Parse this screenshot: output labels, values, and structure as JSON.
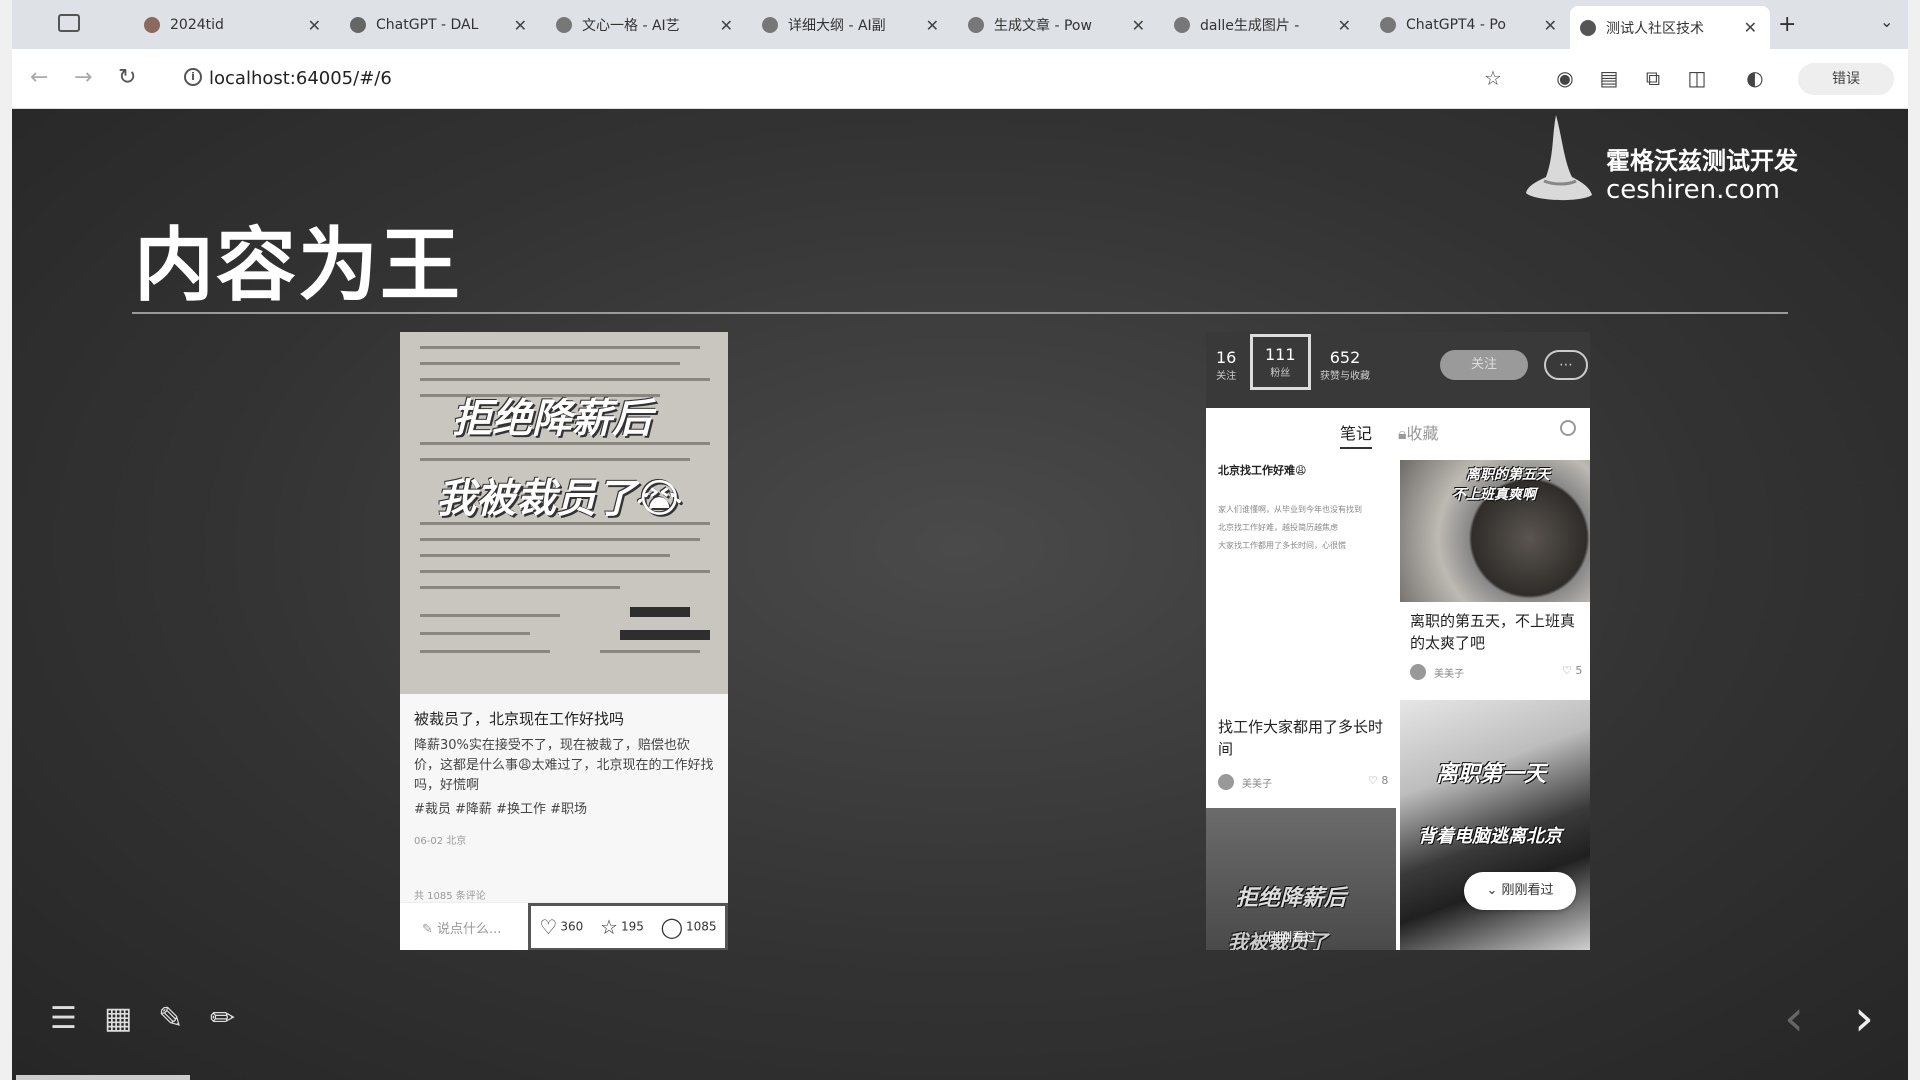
{
  "browser": {
    "tabs": [
      {
        "label": "",
        "kind": "sidebar"
      },
      {
        "label": "2024tid"
      },
      {
        "label": "ChatGPT - DAL"
      },
      {
        "label": "文心一格 - AI艺"
      },
      {
        "label": "详细大纲 - AI副"
      },
      {
        "label": "生成文章 - Pow"
      },
      {
        "label": "dalle生成图片 -"
      },
      {
        "label": "ChatGPT4 - Po"
      },
      {
        "label": "测试人社区技术"
      }
    ],
    "new_tab": "+",
    "tab_menu": "⌄",
    "url": "localhost:64005/#/6",
    "profile_label": "错误"
  },
  "slide": {
    "title": "内容为王",
    "logo_line1": "霍格沃兹测试开发",
    "logo_line2": "ceshiren.com"
  },
  "post": {
    "image_line1": "拒绝降薪后",
    "image_line2": "我被裁员了😭",
    "title": "被裁员了，北京现在工作好找吗",
    "body": "降薪30%实在接受不了，现在被裁了，赔偿也砍价，这都是什么事😩太难过了，北京现在的工作好找吗，好慌啊",
    "tags": "#裁员 #降薪 #换工作 #职场",
    "date": "06-02 北京",
    "comment_total": "共 1085 条评论",
    "say_placeholder": "说点什么...",
    "likes": "360",
    "favorites": "195",
    "comments": "1085"
  },
  "profile": {
    "following_count": "16",
    "following_label": "关注",
    "fans_count": "111",
    "fans_label": "粉丝",
    "likes_count": "652",
    "likes_label": "获赞与收藏",
    "follow_button": "关注",
    "tab_notes": "笔记",
    "tab_collect": "收藏",
    "card1_header": "北京找工作好难😩",
    "card1_lines": [
      "家人们谁懂啊，从毕业到今年也没有找到",
      "北京找工作好难，越投简历越焦虑",
      "大家找工作都用了多长时间，心很慌"
    ],
    "card2_image_text_1": "离职的第五天",
    "card2_image_text_2": "不上班真爽啊",
    "card2_caption": "离职的第五天，不上班真的太爽了吧",
    "card2_author": "美美子",
    "card2_likes": "5",
    "card3_caption": "找工作大家都用了多长时间",
    "card3_author": "美美子",
    "card3_likes": "8",
    "card4_image_text_1": "离职第一天",
    "card4_image_text_2": "背着电脑逃离北京",
    "card5_image_text_1": "拒绝降薪后",
    "card5_image_text_2": "我被裁员了",
    "just_seen": "刚刚看过",
    "just_seen_2": "刚刚看过"
  },
  "colors": {
    "slide_bg": "#333333",
    "title": "#ffffff",
    "rule": "#9a9a9a"
  },
  "icons": [
    "menu-icon",
    "grid-icon",
    "edit-box-icon",
    "pen-icon",
    "prev-arrow-icon",
    "next-arrow-icon"
  ]
}
